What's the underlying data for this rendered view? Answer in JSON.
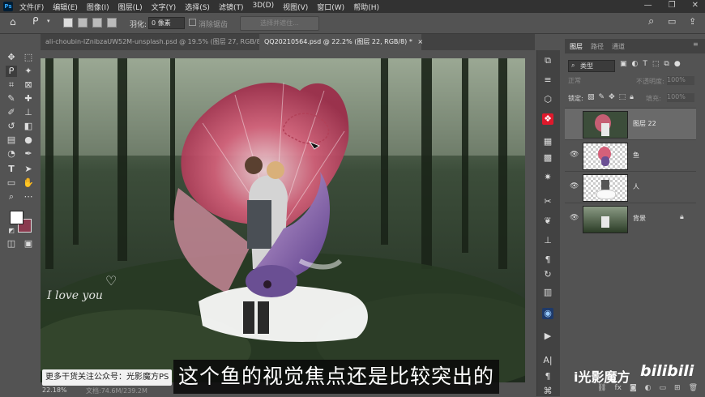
{
  "menubar": {
    "items": [
      "文件(F)",
      "编辑(E)",
      "图像(I)",
      "图层(L)",
      "文字(Y)",
      "选择(S)",
      "滤镜(T)",
      "3D(D)",
      "视图(V)",
      "窗口(W)",
      "帮助(H)"
    ]
  },
  "options": {
    "feather_label": "羽化:",
    "feather_value": "0 像素",
    "antialias_label": "消除锯齿",
    "select_mask_label": "选择并遮住..."
  },
  "tabs": [
    {
      "label": "ali-choubin-IZnibzaUW52M-unsplash.psd @ 19.5% (图层 27, RGB/8) *"
    },
    {
      "label": "QQ20210564.psd @ 22.2% (图层 22, RGB/8) *"
    }
  ],
  "status": {
    "zoom": "22.18%",
    "doc": "文档:74.6M/239.2M"
  },
  "layers_panel": {
    "tabs": [
      "图层",
      "路径",
      "通道"
    ],
    "filter_kind": "类型",
    "blend_mode": "正常",
    "opacity_label": "不透明度:",
    "opacity_value": "100%",
    "lock_label": "锁定:",
    "fill_label": "填充:",
    "fill_value": "100%",
    "layers": [
      {
        "name": "图层 22"
      },
      {
        "name": "鱼"
      },
      {
        "name": "人"
      },
      {
        "name": "背景"
      }
    ]
  },
  "overlay": {
    "subtitle": "这个鱼的视觉焦点还是比较突出的",
    "banner": "更多干货关注公众号：光影魔方PS",
    "watermark": "i光影魔方",
    "platform": "bilibili",
    "artwork_text": "I love you"
  },
  "colors": {
    "foreground": "#ffffff",
    "background": "#8a3a4e",
    "accent": "#e0192c"
  }
}
